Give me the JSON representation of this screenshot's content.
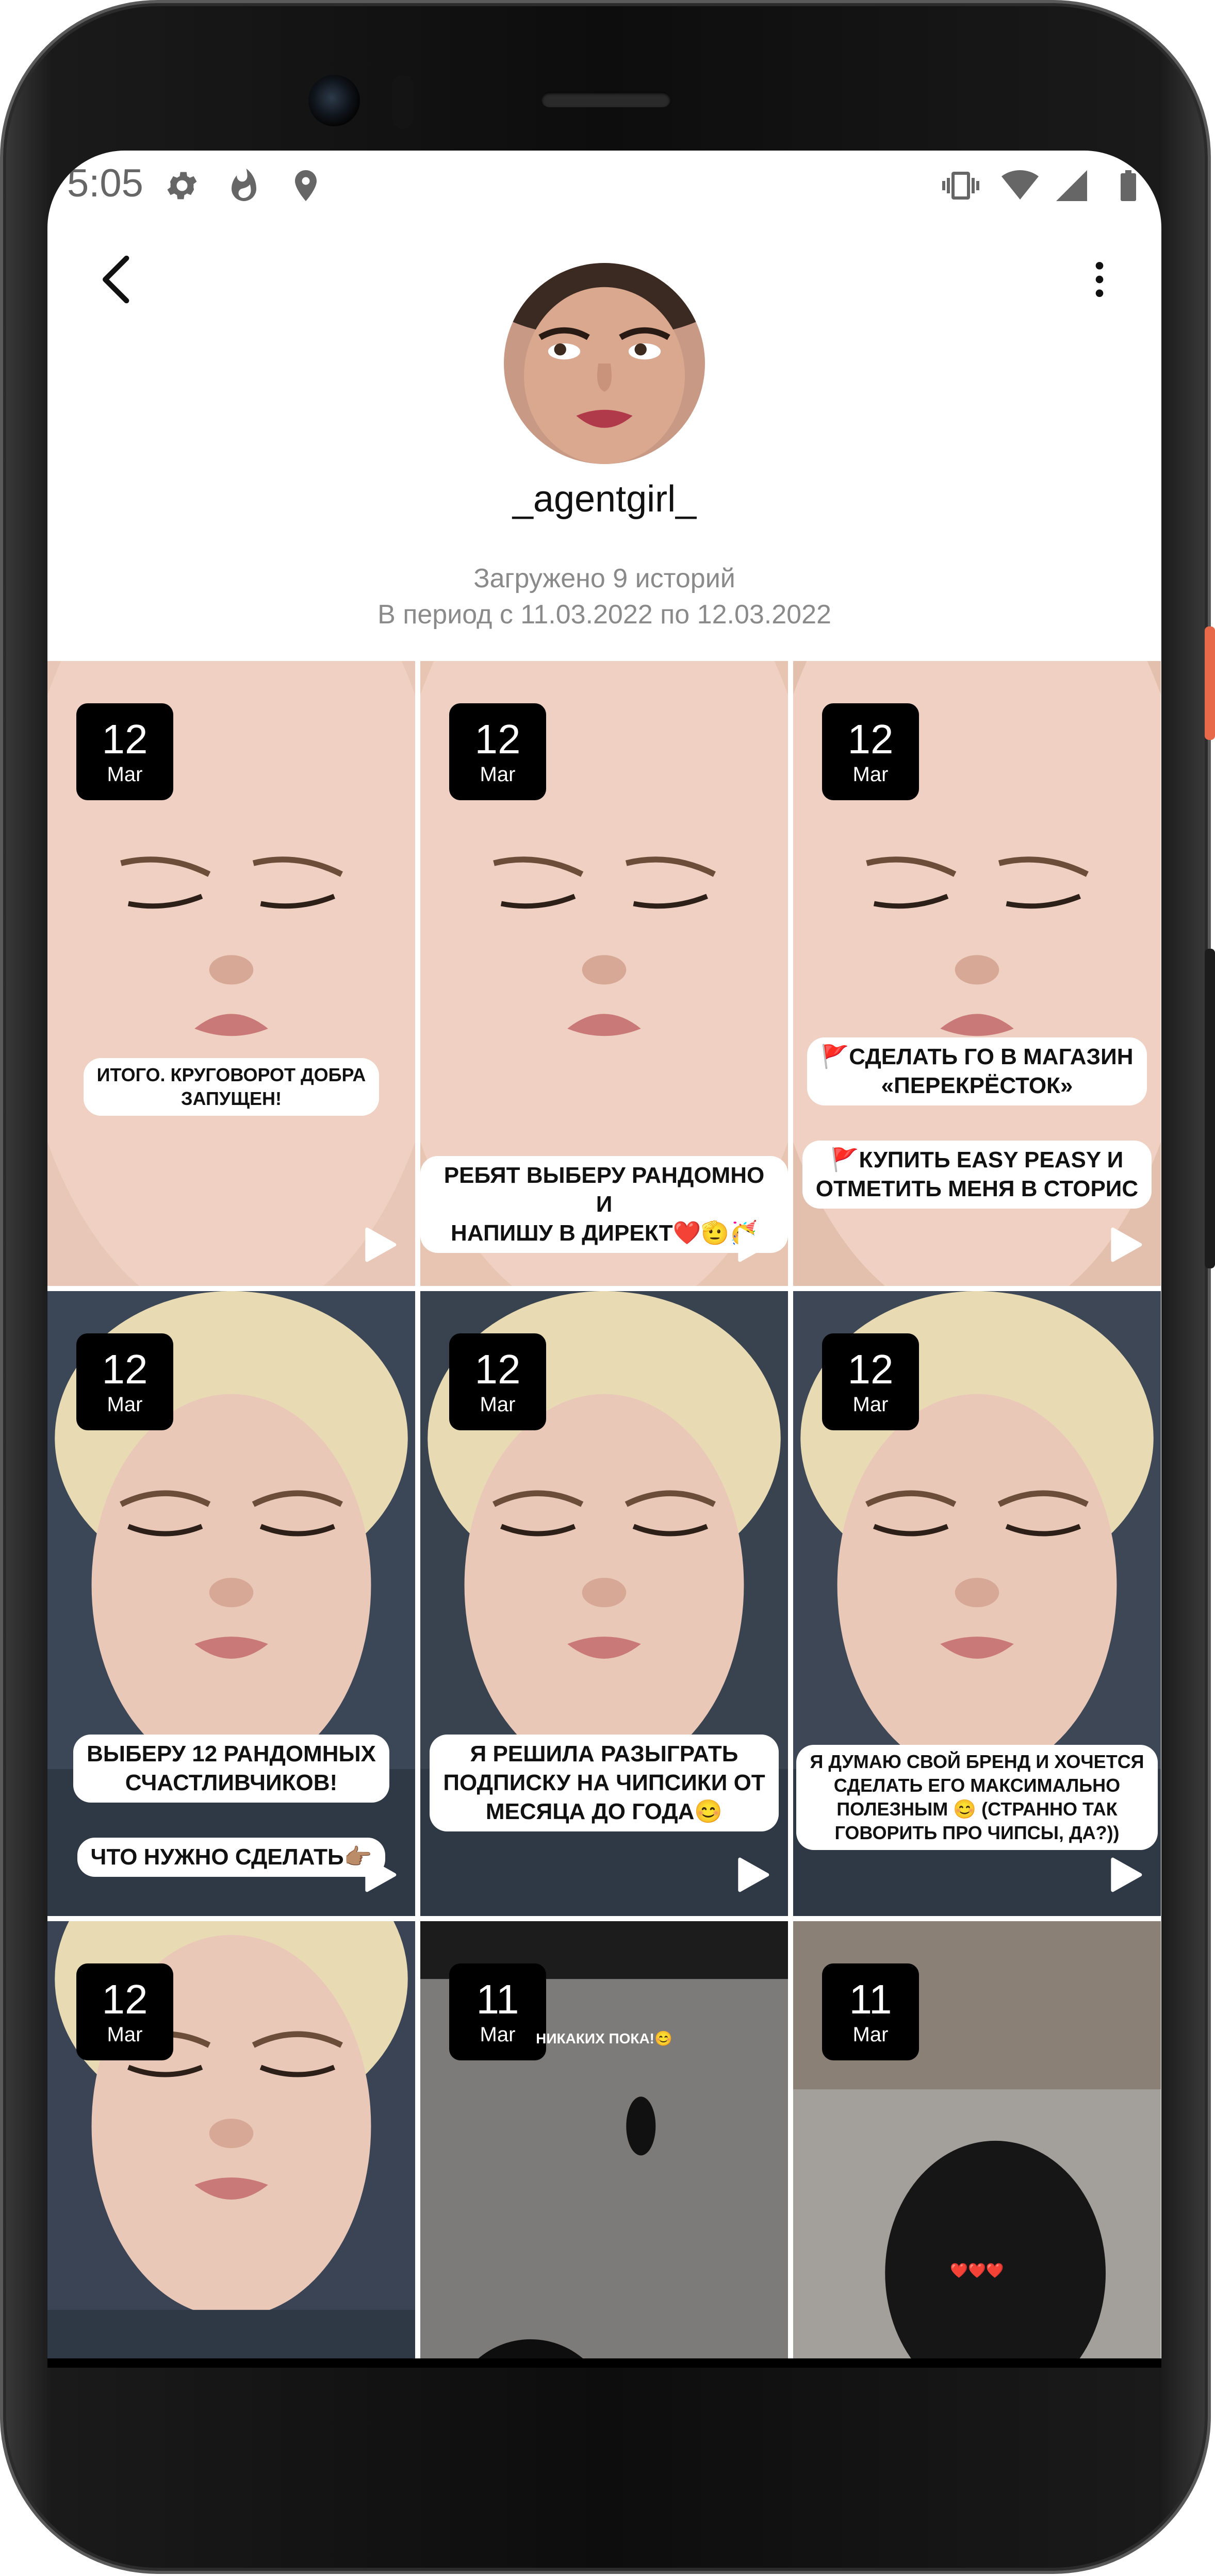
{
  "status_bar": {
    "time": "5:05",
    "left_icons": [
      "gear-icon",
      "flame-icon",
      "location-icon"
    ],
    "right_icons": [
      "vibrate-icon",
      "wifi-icon",
      "signal-icon",
      "battery-icon"
    ]
  },
  "profile": {
    "username": "_agentgirl_",
    "stories_loaded": "Загружено 9 историй",
    "period": "В период с 11.03.2022 по 12.03.2022"
  },
  "stories": [
    {
      "day": "12",
      "month": "Mar",
      "caption_lines": [
        "ИТОГО. КРУГОВОРОТ ДОБРА",
        "ЗАПУЩЕН!"
      ],
      "bg": "#e9c7b8"
    },
    {
      "day": "12",
      "month": "Mar",
      "caption_lines": [
        "РЕБЯТ ВЫБЕРУ РАНДОМНО И",
        "НАПИШУ В ДИРЕКТ❤️🫡🥳"
      ],
      "bg": "#e7c5b2"
    },
    {
      "day": "12",
      "month": "Mar",
      "caption_lines": [
        "🚩СДЕЛАТЬ ГО В МАГАЗИН",
        "«ПЕРЕКРЁСТОК»"
      ],
      "caption2_lines": [
        "🚩КУПИТЬ EASY PEASY И",
        "ОТМЕТИТЬ МЕНЯ В СТОРИС"
      ],
      "bg": "#e3c0ad"
    },
    {
      "day": "12",
      "month": "Mar",
      "caption_lines": [
        "ВЫБЕРУ 12 РАНДОМНЫХ",
        "СЧАСТЛИВЧИКОВ!"
      ],
      "caption2_lines": [
        "ЧТО НУЖНО СДЕЛАТЬ👉🏽"
      ],
      "bg": "#3b4656"
    },
    {
      "day": "12",
      "month": "Mar",
      "caption_lines": [
        "Я РЕШИЛА РАЗЫГРАТЬ",
        "ПОДПИСКУ НА ЧИПСИКИ ОТ",
        "МЕСЯЦА ДО ГОДА😊"
      ],
      "bg": "#39424f"
    },
    {
      "day": "12",
      "month": "Mar",
      "caption_lines": [
        "Я ДУМАЮ СВОЙ БРЕНД И ХОЧЕТСЯ",
        "СДЕЛАТЬ ЕГО МАКСИМАЛЬНО",
        "ПОЛЕЗНЫМ 😊 (СТРАННО ТАК",
        "ГОВОРИТЬ ПРО ЧИПСЫ, ДА?))"
      ],
      "bg": "#3d4756"
    },
    {
      "day": "12",
      "month": "Mar",
      "caption_lines": [],
      "bg": "#3b4454"
    },
    {
      "day": "11",
      "month": "Mar",
      "caption_lines": [
        "НИКАКИХ ПОКА!😊"
      ],
      "bg": "#1d1c1c"
    },
    {
      "day": "11",
      "month": "Mar",
      "caption_lines": [
        "❤️❤️❤️"
      ],
      "bg": "#6a6661"
    }
  ],
  "navigation": {
    "back": "back-triangle-icon",
    "home": "home-circle-icon",
    "recent": "recent-square-icon"
  },
  "colors": {
    "badge_bg": "#000000",
    "text_secondary": "#8a8a8a",
    "accent_power": "#e8684a"
  }
}
